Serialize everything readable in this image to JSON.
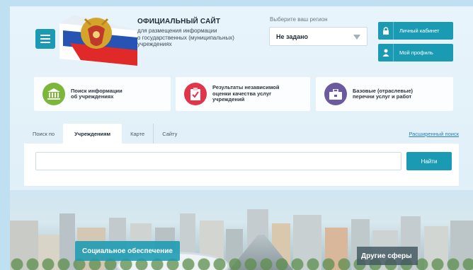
{
  "header": {
    "site_title": "ОФИЦИАЛЬНЫЙ САЙТ",
    "site_subtitle_1": "для размещения информации",
    "site_subtitle_2": "о государственных (муниципальных)",
    "site_subtitle_3": "учреждениях",
    "menu_icon": "hamburger-icon",
    "emblem_icon": "russian-coat-of-arms-flag"
  },
  "region": {
    "label": "Выберите ваш регион",
    "selected": "Не задано"
  },
  "account": {
    "cabinet_label": "Личный кабинет",
    "cabinet_icon": "lock-icon",
    "profile_label": "Мой профиль",
    "profile_icon": "person-icon"
  },
  "cards": [
    {
      "line1": "Поиск информации",
      "line2": "об учреждениях",
      "line3": "",
      "icon": "institution-icon",
      "color": "#7db73a"
    },
    {
      "line1": "Результаты независимой",
      "line2": "оценки качества услуг",
      "line3": "учреждений",
      "icon": "checklist-icon",
      "color": "#e0354b"
    },
    {
      "line1": "Базовые (отраслевые)",
      "line2": "перечни услуг и работ",
      "line3": "",
      "icon": "briefcase-icon",
      "color": "#6c5aa0"
    }
  ],
  "search": {
    "tab_prefix": "Поиск по",
    "tab_institutions": "Учреждениям",
    "tab_map": "Карте",
    "tab_site": "Сайту",
    "advanced_link": "Расширенный поиск",
    "input_value": "",
    "button_label": "Найти"
  },
  "banner": {
    "social_label": "Социальное обеспечение",
    "other_label": "Другие сферы"
  },
  "colors": {
    "accent": "#1a9bb3",
    "link": "#2a7fb8"
  }
}
